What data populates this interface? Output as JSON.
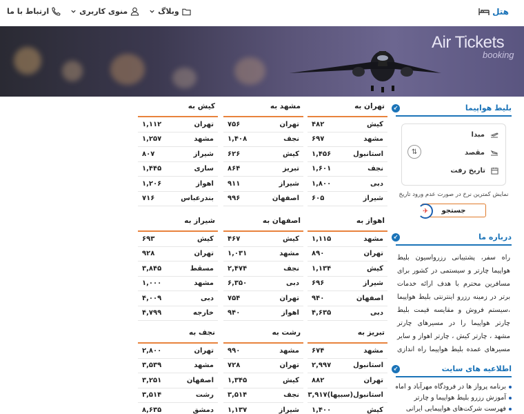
{
  "header": {
    "brand": "هتل",
    "nav": [
      {
        "label": "ارتباط با ما",
        "icon": "phone-icon"
      },
      {
        "label": "منوی کاربری",
        "icon": "user-icon"
      },
      {
        "label": "وبلاگ",
        "icon": "folder-icon"
      }
    ]
  },
  "banner": {
    "title": "Air Tickets",
    "subtitle": "booking"
  },
  "sidebar": {
    "flight_box": {
      "title": "بلیط هواپیما",
      "origin": "مبدا",
      "destination": "مقصد",
      "date": "تاریخ رفت",
      "note": "نمایش کمترین نرخ در صورت عدم ورود تاریخ",
      "search": "جستجو"
    },
    "about": {
      "title": "درباره ما",
      "text": "راه سفر، پشتیبانی رزرواسیون بلیط هواپیما چارتر و سیستمی در کشور برای مسافرین محترم با هدف ارائه خدمات برتر در زمینه رزرو اینترنتی بلیط هواپیما ،سیستم فروش و مقایسه قیمت بلیط چارتر هواپیما را در مسیرهای چارتر مشهد ، چارتر کیش ، چارتر اهواز و سایر مسیرهای عمده بلیط هواپیما راه اندازی نمود.این وب سایت رزرو بلیط هواپیما اجازه می دهد تا آژانس های چارتر کننده بلیط هواپیمای خود را عرضه کنند"
    },
    "info": {
      "title": "اطلاعیه های سایت",
      "items": [
        "برنامه پرواز ها در فرودگاه مهرآباد و امام ...",
        "آموزش رزرو بلیط هواپیما و چارتر",
        "فهرست شرکت‌های هواپیمایی ایرانی"
      ]
    }
  },
  "routes": [
    {
      "title": "تهران به",
      "rows": [
        [
          "کیش",
          "۴۸۲"
        ],
        [
          "مشهد",
          "۶۹۷"
        ],
        [
          "استانبول",
          "۱,۴۵۶"
        ],
        [
          "نجف",
          "۱,۶۰۱"
        ],
        [
          "دبی",
          "۱,۸۰۰"
        ],
        [
          "شیراز",
          "۶۰۵"
        ]
      ]
    },
    {
      "title": "مشهد به",
      "rows": [
        [
          "تهران",
          "۷۵۶"
        ],
        [
          "نجف",
          "۱,۴۰۸"
        ],
        [
          "کیش",
          "۶۲۶"
        ],
        [
          "تبریز",
          "۸۶۴"
        ],
        [
          "شیراز",
          "۹۱۱"
        ],
        [
          "اصفهان",
          "۹۹۶"
        ]
      ]
    },
    {
      "title": "کیش به",
      "rows": [
        [
          "تهران",
          "۱,۱۱۲"
        ],
        [
          "مشهد",
          "۱,۲۵۷"
        ],
        [
          "شیراز",
          "۸۰۷"
        ],
        [
          "ساری",
          "۱,۴۴۵"
        ],
        [
          "اهواز",
          "۱,۲۰۶"
        ],
        [
          "بندرعباس",
          "۷۱۶"
        ]
      ]
    },
    {
      "title": "اهواز به",
      "rows": [
        [
          "مشهد",
          "۱,۱۱۵"
        ],
        [
          "تهران",
          "۸۹۰"
        ],
        [
          "کیش",
          "۱,۱۳۴"
        ],
        [
          "شیراز",
          "۶۹۶"
        ],
        [
          "اصفهان",
          "۹۴۰"
        ],
        [
          "دبی",
          "۴,۶۳۵"
        ]
      ]
    },
    {
      "title": "اصفهان به",
      "rows": [
        [
          "کیش",
          "۴۶۷"
        ],
        [
          "مشهد",
          "۱,۰۳۱"
        ],
        [
          "نجف",
          "۲,۴۷۴"
        ],
        [
          "دبی",
          "۶,۳۵۰"
        ],
        [
          "تهران",
          "۷۵۴"
        ],
        [
          "اهواز",
          "۹۴۰"
        ]
      ]
    },
    {
      "title": "شیراز به",
      "rows": [
        [
          "کیش",
          "۶۹۳"
        ],
        [
          "تهران",
          "۹۲۸"
        ],
        [
          "مسقط",
          "۳,۸۴۵"
        ],
        [
          "مشهد",
          "۱,۰۰۰"
        ],
        [
          "دبی",
          "۴,۰۰۹"
        ],
        [
          "خارجه",
          "۴,۷۹۹"
        ]
      ]
    },
    {
      "title": "تبریز به",
      "rows": [
        [
          "مشهد",
          "۶۷۴"
        ],
        [
          "استانبول",
          "۲,۹۹۷"
        ],
        [
          "تهران",
          "۸۸۲"
        ],
        [
          "استانبول(سبیها)",
          "۳,۹۱۷"
        ],
        [
          "کیش",
          "۱,۴۰۰"
        ]
      ]
    },
    {
      "title": "رشت به",
      "rows": [
        [
          "مشهد",
          "۹۹۰"
        ],
        [
          "تهران",
          "۷۲۸"
        ],
        [
          "کیش",
          "۱,۳۴۵"
        ],
        [
          "نجف",
          "۳,۵۱۴"
        ],
        [
          "شیراز",
          "۱,۱۳۷"
        ]
      ]
    },
    {
      "title": "نجف به",
      "rows": [
        [
          "تهران",
          "۲,۸۰۰"
        ],
        [
          "مشهد",
          "۳,۵۳۹"
        ],
        [
          "اصفهان",
          "۳,۲۵۱"
        ],
        [
          "رشت",
          "۳,۵۱۴"
        ],
        [
          "دمشق",
          "۸,۶۳۵"
        ]
      ]
    }
  ]
}
